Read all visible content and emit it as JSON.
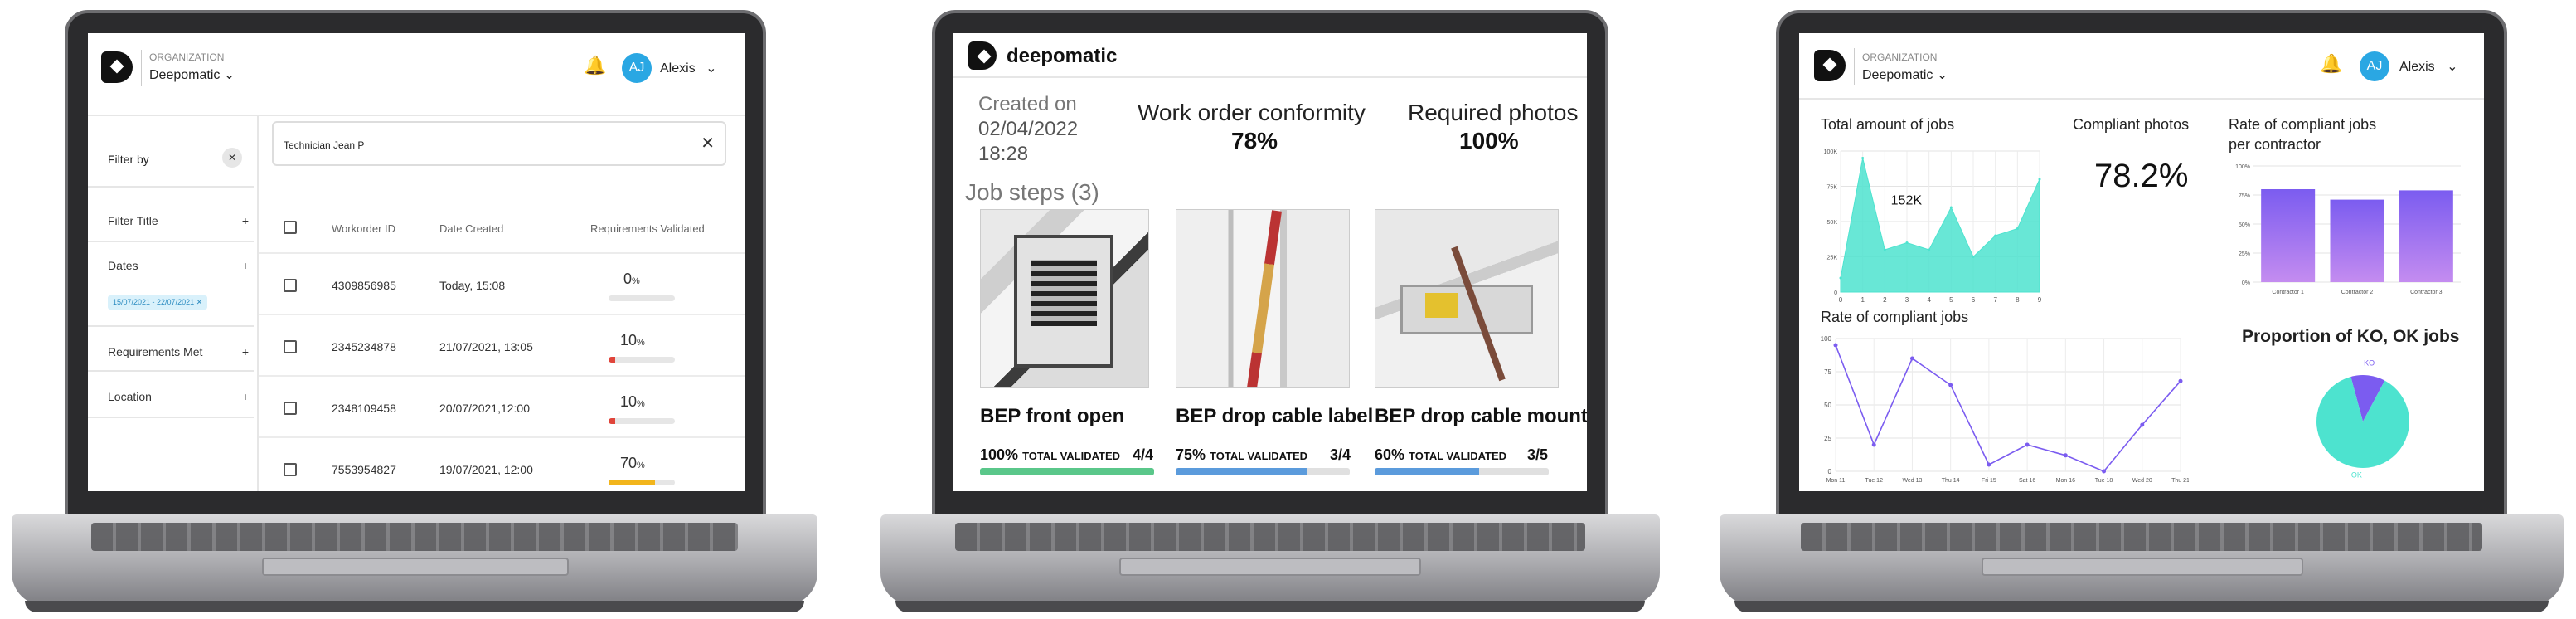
{
  "left": {
    "org_label": "ORGANIZATION",
    "org_name": "Deepomatic",
    "user_initials": "AJ",
    "user_name": "Alexis",
    "filter_by": "Filter by",
    "filters": [
      "Filter Title",
      "Dates",
      "Requirements Met",
      "Location"
    ],
    "date_chip": "15/07/2021 - 22/07/2021",
    "search_value": "Technician Jean P",
    "columns": [
      "Workorder ID",
      "Date Created",
      "Requirements Validated"
    ],
    "rows": [
      {
        "id": "4309856985",
        "date": "Today, 15:08",
        "pct": "0",
        "value": 0,
        "color": "#cfcfcf"
      },
      {
        "id": "2345234878",
        "date": "21/07/2021, 13:05",
        "pct": "10",
        "value": 10,
        "color": "#e0443a"
      },
      {
        "id": "2348109458",
        "date": "20/07/2021,12:00",
        "pct": "10",
        "value": 10,
        "color": "#e0443a"
      },
      {
        "id": "7553954827",
        "date": "19/07/2021, 12:00",
        "pct": "70",
        "value": 70,
        "color": "#f2b51c"
      }
    ],
    "pct_unit": "%"
  },
  "middle": {
    "brand": "deepomatic",
    "created_label": "Created on",
    "created_date": "02/04/2022",
    "created_time": "18:28",
    "conformity_label": "Work order conformity",
    "conformity_value": "78%",
    "photos_label": "Required photos",
    "photos_value": "100%",
    "job_steps": "Job steps (3)",
    "total_validated": "TOTAL VALIDATED",
    "steps": [
      {
        "title": "BEP front open",
        "pct": "100%",
        "count": "4/4",
        "value": 100,
        "color": "#5ac78a"
      },
      {
        "title": "BEP drop cable label",
        "pct": "75%",
        "count": "3/4",
        "value": 75,
        "color": "#5b9bdc"
      },
      {
        "title": "BEP drop cable mounting",
        "pct": "60%",
        "count": "3/5",
        "value": 60,
        "color": "#5b9bdc"
      }
    ]
  },
  "right": {
    "org_label": "ORGANIZATION",
    "org_name": "Deepomatic",
    "user_initials": "AJ",
    "user_name": "Alexis",
    "total_jobs_title": "Total amount of jobs",
    "total_jobs_annotation": "152K",
    "compliant_title": "Compliant photos",
    "compliant_value": "78.2%",
    "contractor_title_1": "Rate of compliant jobs",
    "contractor_title_2": "per contractor",
    "rate_title": "Rate of compliant jobs",
    "pie_title": "Proportion of KO, OK jobs",
    "accent": "#4de3cf",
    "purple": "#7b5cf0"
  },
  "chart_data": [
    {
      "type": "area",
      "title": "Total amount of jobs",
      "x": [
        0,
        1,
        2,
        3,
        4,
        5,
        6,
        7,
        8,
        9
      ],
      "values": [
        10,
        95,
        30,
        35,
        30,
        60,
        25,
        40,
        45,
        80
      ],
      "ylim": [
        0,
        100
      ],
      "yticks": [
        "0",
        "25K",
        "50K",
        "75K",
        "100K"
      ],
      "xticks": [
        "0",
        "1",
        "2",
        "3",
        "4",
        "5",
        "6",
        "7",
        "8",
        "9"
      ]
    },
    {
      "type": "bar",
      "title": "Rate of compliant jobs per contractor",
      "categories": [
        "Contractor 1",
        "Contractor 2",
        "Contractor 3"
      ],
      "values": [
        80,
        71,
        79
      ],
      "ylim": [
        0,
        100
      ],
      "yticks": [
        "0%",
        "25%",
        "50%",
        "75%",
        "100%"
      ]
    },
    {
      "type": "line",
      "title": "Rate of compliant jobs",
      "categories": [
        "Mon 11",
        "Tue 12",
        "Wed 13",
        "Thu 14",
        "Fri 15",
        "Sat 16",
        "Mon 16",
        "Tue 18",
        "Wed 20",
        "Thu 21"
      ],
      "values": [
        95,
        20,
        85,
        65,
        5,
        20,
        12,
        0,
        35,
        68
      ],
      "ylim": [
        0,
        100
      ],
      "yticks": [
        "0",
        "25",
        "50",
        "75",
        "100"
      ]
    },
    {
      "type": "pie",
      "title": "Proportion of KO, OK jobs",
      "categories": [
        "KO",
        "OK"
      ],
      "values": [
        12,
        88
      ]
    }
  ]
}
